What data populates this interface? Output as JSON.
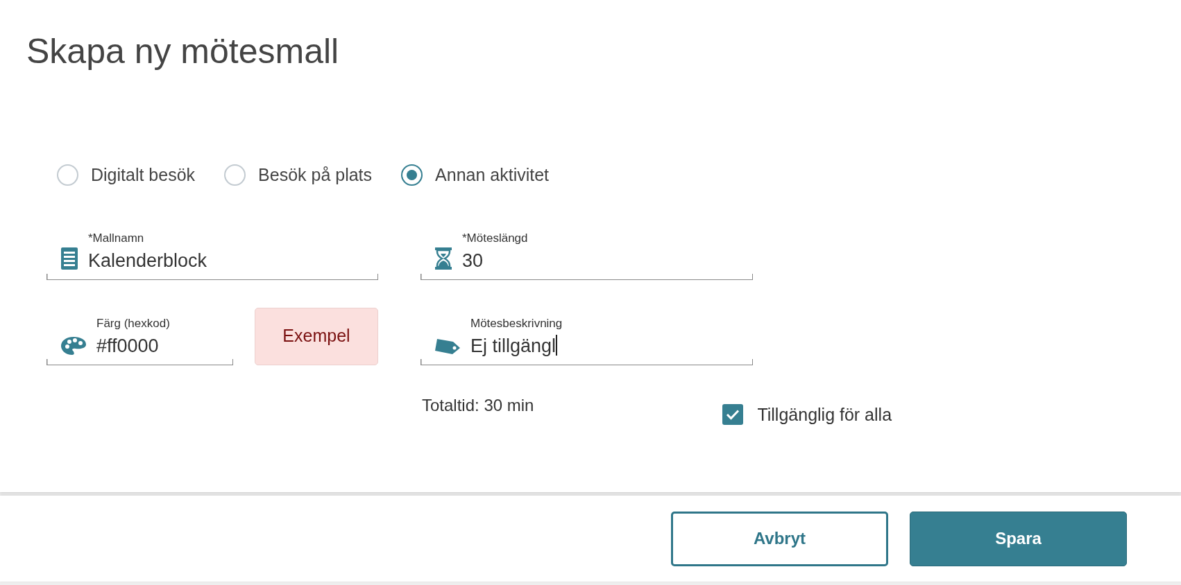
{
  "title": "Skapa ny mötesmall",
  "meeting_types": [
    {
      "label": "Digitalt besök",
      "selected": false
    },
    {
      "label": "Besök på plats",
      "selected": false
    },
    {
      "label": "Annan aktivitet",
      "selected": true
    }
  ],
  "fields": [
    {
      "label": "*Mallnamn",
      "value": "Kalenderblock",
      "focused": false
    },
    {
      "label": "*Möteslängd",
      "value": "30",
      "focused": false
    },
    {
      "label": "Färg (hexkod)",
      "value": "#ff0000",
      "focused": false
    },
    {
      "label": "Mötesbeskrivning",
      "value": "Ej tillgängl",
      "focused": true
    }
  ],
  "color_preview": "Exempel",
  "total_time": "Totaltid: 30 min",
  "available_for_all": {
    "label": "Tillgänglig för alla",
    "checked": true
  },
  "buttons": [
    {
      "label": "Avbryt",
      "kind": "secondary"
    },
    {
      "label": "Spara",
      "kind": "primary"
    }
  ]
}
